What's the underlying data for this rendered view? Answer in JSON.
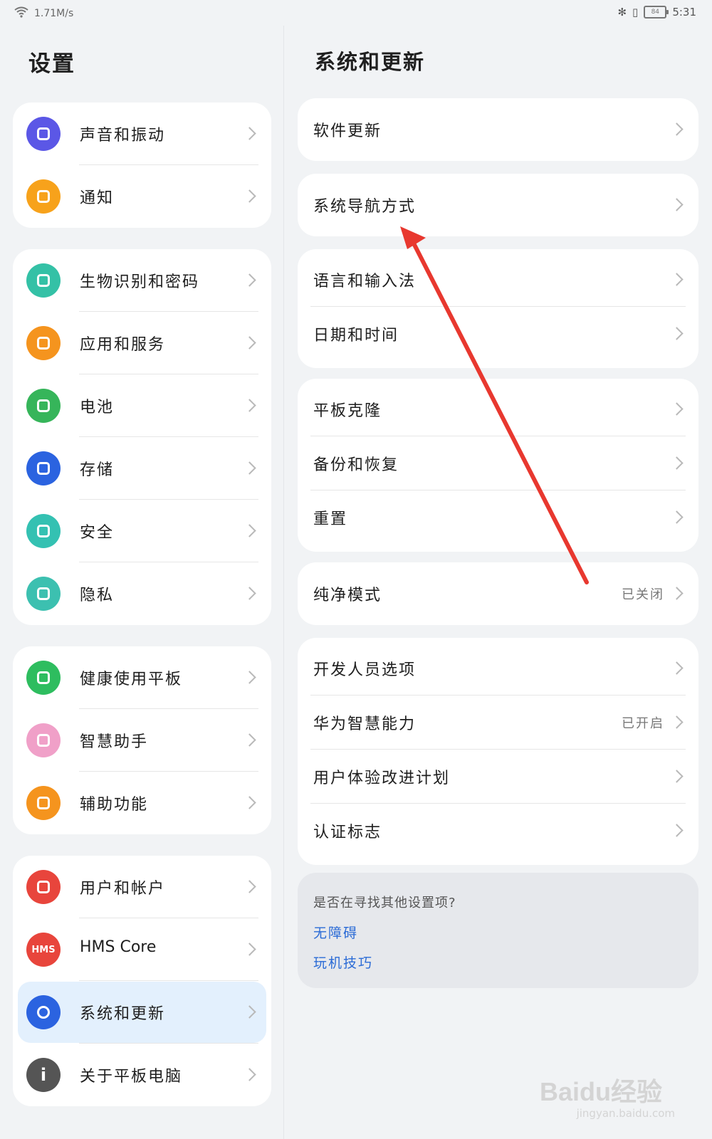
{
  "status_bar": {
    "speed": "1.71M/s",
    "battery": "84",
    "time": "5:31"
  },
  "left_panel": {
    "title": "设置",
    "groups": [
      [
        {
          "label": "声音和振动",
          "icon": "sound-icon",
          "color": "#5b57e6"
        },
        {
          "label": "通知",
          "icon": "bell-icon",
          "color": "#f7a21b"
        }
      ],
      [
        {
          "label": "生物识别和密码",
          "icon": "key-icon",
          "color": "#34c1a6"
        },
        {
          "label": "应用和服务",
          "icon": "apps-icon",
          "color": "#f5941e"
        },
        {
          "label": "电池",
          "icon": "battery-icon",
          "color": "#36b55a"
        },
        {
          "label": "存储",
          "icon": "storage-icon",
          "color": "#2b63e0"
        },
        {
          "label": "安全",
          "icon": "shield-check-icon",
          "color": "#34c1b2"
        },
        {
          "label": "隐私",
          "icon": "privacy-icon",
          "color": "#3cc0b0"
        }
      ],
      [
        {
          "label": "健康使用平板",
          "icon": "hourglass-icon",
          "color": "#2ebd5f"
        },
        {
          "label": "智慧助手",
          "icon": "assistant-icon",
          "color": "#f0a0c8"
        },
        {
          "label": "辅助功能",
          "icon": "hand-icon",
          "color": "#f5941e"
        }
      ],
      [
        {
          "label": "用户和帐户",
          "icon": "user-icon",
          "color": "#e8453c"
        },
        {
          "label": "HMS Core",
          "icon": "hms-icon",
          "color": "#e8453c",
          "icon_text": "HMS"
        },
        {
          "label": "系统和更新",
          "icon": "gear-icon",
          "color": "#2b63e0",
          "active": true
        },
        {
          "label": "关于平板电脑",
          "icon": "info-icon",
          "color": "#555555",
          "icon_text": "i"
        }
      ]
    ]
  },
  "right_panel": {
    "title": "系统和更新",
    "groups": [
      [
        {
          "label": "软件更新"
        }
      ],
      [
        {
          "label": "系统导航方式"
        }
      ],
      [
        {
          "label": "语言和输入法"
        },
        {
          "label": "日期和时间"
        }
      ],
      [
        {
          "label": "平板克隆"
        },
        {
          "label": "备份和恢复"
        },
        {
          "label": "重置"
        }
      ],
      [
        {
          "label": "纯净模式",
          "value": "已关闭"
        }
      ],
      [
        {
          "label": "开发人员选项"
        },
        {
          "label": "华为智慧能力",
          "value": "已开启"
        },
        {
          "label": "用户体验改进计划"
        },
        {
          "label": "认证标志"
        }
      ]
    ],
    "suggest": {
      "question": "是否在寻找其他设置项?",
      "links": [
        "无障碍",
        "玩机技巧"
      ]
    }
  },
  "annotation_color": "#e8382f",
  "watermark": {
    "brand": "Baidu经验",
    "url": "jingyan.baidu.com"
  }
}
